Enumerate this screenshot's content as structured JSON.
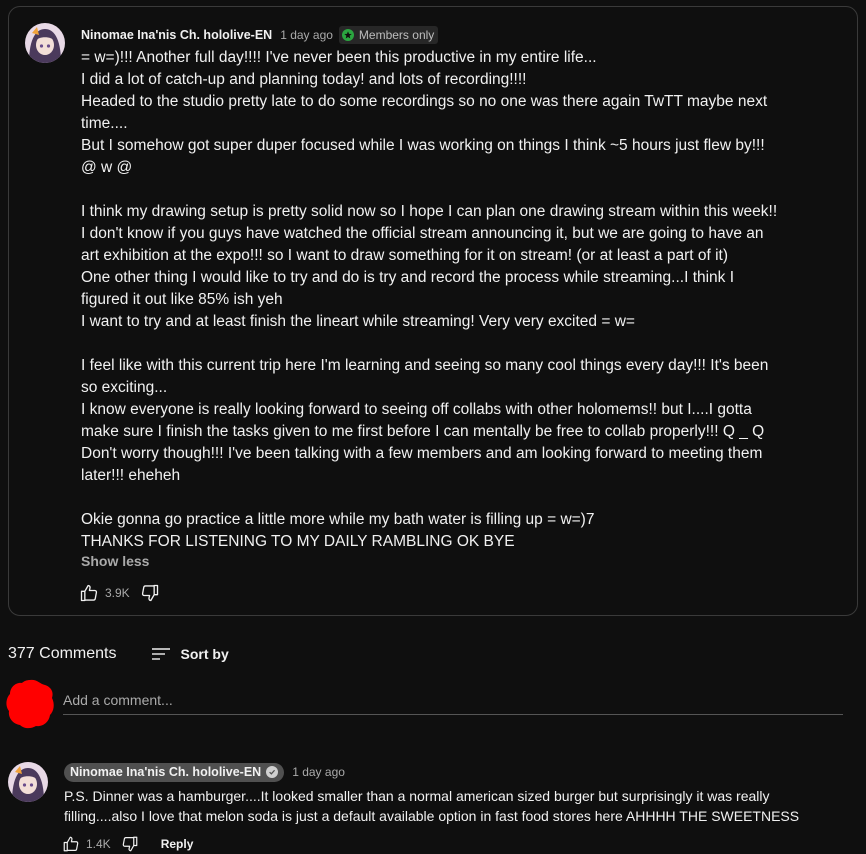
{
  "post": {
    "author": "Ninomae Ina'nis Ch. hololive-EN",
    "time": "1 day ago",
    "badge": "Members only",
    "lines": [
      "= w=)!!! Another full day!!!! I've never been this productive in my entire life...",
      "I did a lot of catch-up and planning today! and lots of recording!!!!",
      "Headed to the studio pretty late to do some recordings so no one was there again TwTT maybe next",
      "time....",
      "But I somehow got super duper focused while I was working on things I think ~5 hours just flew by!!!",
      "@ w @",
      "",
      "I think my drawing setup is pretty solid now so I hope I can plan one drawing stream within this week!!",
      "I don't know if you guys have watched the official stream announcing it, but we are going to have an",
      "art exhibition at the expo!!! so I want to draw something for it on stream! (or at least a part of it)",
      "One other thing I would like to try and do is try and record the process while streaming...I think I",
      "figured it out like 85% ish yeh",
      "I want to try and at least finish the lineart while streaming! Very very excited = w=",
      "",
      "I feel like with this current trip here I'm learning and seeing so many cool things every day!!! It's been",
      "so exciting...",
      "I know everyone is really looking forward to seeing off collabs with other holomems!! but I....I gotta",
      "make sure I finish the tasks given to me first before I can mentally be free to collab properly!!! Q _  Q",
      "Don't worry though!!! I've been talking with a few members and am looking forward to meeting them",
      "later!!! eheheh",
      "",
      "Okie gonna go practice a little more while my bath water is filling up = w=)7",
      "THANKS FOR LISTENING TO MY DAILY RAMBLING OK BYE"
    ],
    "show_less": "Show less",
    "like_count": "3.9K"
  },
  "comments_section": {
    "count_label": "377 Comments",
    "sort_label": "Sort by",
    "add_placeholder": "Add a comment..."
  },
  "comment": {
    "author": "Ninomae Ina'nis Ch. hololive-EN",
    "time": "1 day ago",
    "lines": [
      "P.S. Dinner was a hamburger....It looked smaller than a normal american sized burger but surprisingly it was really",
      "filling....also I love that melon soda is just a default available option in fast food stores here AHHHH THE SWEETNESS"
    ],
    "like_count": "1.4K",
    "reply_label": "Reply"
  },
  "colors": {
    "background": "#0f0f0f",
    "text": "#f1f1f1",
    "secondary_text": "#aaaaaa",
    "members_badge_icon": "#2ba640",
    "user_avatar": "#ff0000"
  },
  "icons": [
    "members-star-icon",
    "thumb-up-icon",
    "thumb-down-icon",
    "sort-icon",
    "verified-check-icon"
  ]
}
